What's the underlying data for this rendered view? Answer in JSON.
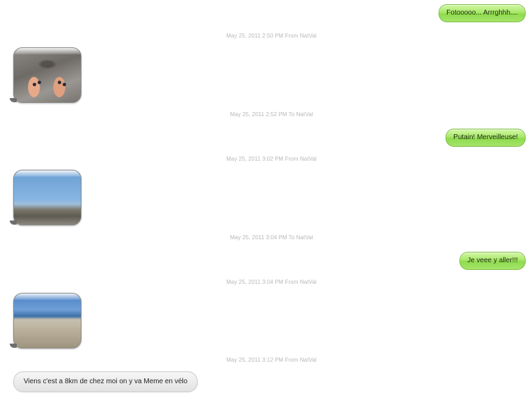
{
  "thread": {
    "messages": [
      {
        "kind": "outgoing-text",
        "text": "Fotooooo... Arrrghhh...."
      },
      {
        "kind": "timestamp",
        "text": "May 25, 2011 2:50 PM From NatVal"
      },
      {
        "kind": "incoming-photo",
        "subject": "feet on sand"
      },
      {
        "kind": "timestamp",
        "text": "May 25, 2011 2:52 PM To NatVal"
      },
      {
        "kind": "outgoing-text",
        "text": "Putain! Merveilleuse!"
      },
      {
        "kind": "timestamp",
        "text": "May 25, 2011 3:02 PM From NatVal"
      },
      {
        "kind": "incoming-photo",
        "subject": "coastline"
      },
      {
        "kind": "timestamp",
        "text": "May 25, 2011 3:04 PM To NatVal"
      },
      {
        "kind": "outgoing-text",
        "text": "Je veee y aller!!!"
      },
      {
        "kind": "timestamp",
        "text": "May 25, 2011 3:04 PM From NatVal"
      },
      {
        "kind": "incoming-photo",
        "subject": "beach"
      },
      {
        "kind": "timestamp",
        "text": "May 25, 2011 3:12 PM From NatVal"
      },
      {
        "kind": "incoming-text",
        "text": "Viens c'est a 8km de chez moi on y va Meme en vélo"
      }
    ]
  },
  "colors": {
    "outgoing_bubble": "#a8e86a",
    "incoming_bubble": "#ececec",
    "timestamp_text": "#b7b7b7"
  }
}
